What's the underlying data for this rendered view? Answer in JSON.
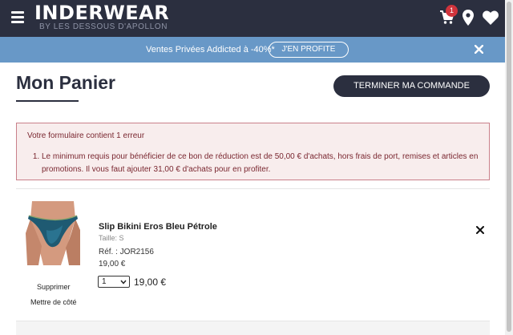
{
  "header": {
    "logo_main": "INDERWEAR",
    "logo_sub": "BY LES DESSOUS D'APOLLON",
    "cart_count": "1",
    "bg_color": "#2b2f3f"
  },
  "promo": {
    "text": "Ventes Privées Addicted à -40%*",
    "button_label": "J'EN PROFITE",
    "bg_color": "#6898c7"
  },
  "main": {
    "title": "Mon Panier",
    "checkout_label": "TERMINER MA COMMANDE"
  },
  "error": {
    "title": "Votre formulaire contient 1 erreur",
    "items": [
      "Le minimum requis pour bénéficier de ce bon de réduction est de 50,00 € d'achats, hors frais de port, remises et articles en promotions. Il vous faut ajouter 31,00 € d'achats pour en profiter."
    ]
  },
  "cart": {
    "items": [
      {
        "name": "Slip Bikini Eros Bleu Pétrole",
        "size": "Taille: S",
        "ref": "Réf. : JOR2156",
        "unit_price": "19,00 €",
        "qty": "1",
        "line_price": "19,00 €",
        "delete_label": "Supprimer",
        "save_later_label": "Mettre de côté"
      }
    ]
  },
  "icons": {
    "menu": "hamburger-icon",
    "cart": "cart-icon",
    "location": "map-pin-icon",
    "wishlist": "heart-icon",
    "close": "close-icon"
  }
}
